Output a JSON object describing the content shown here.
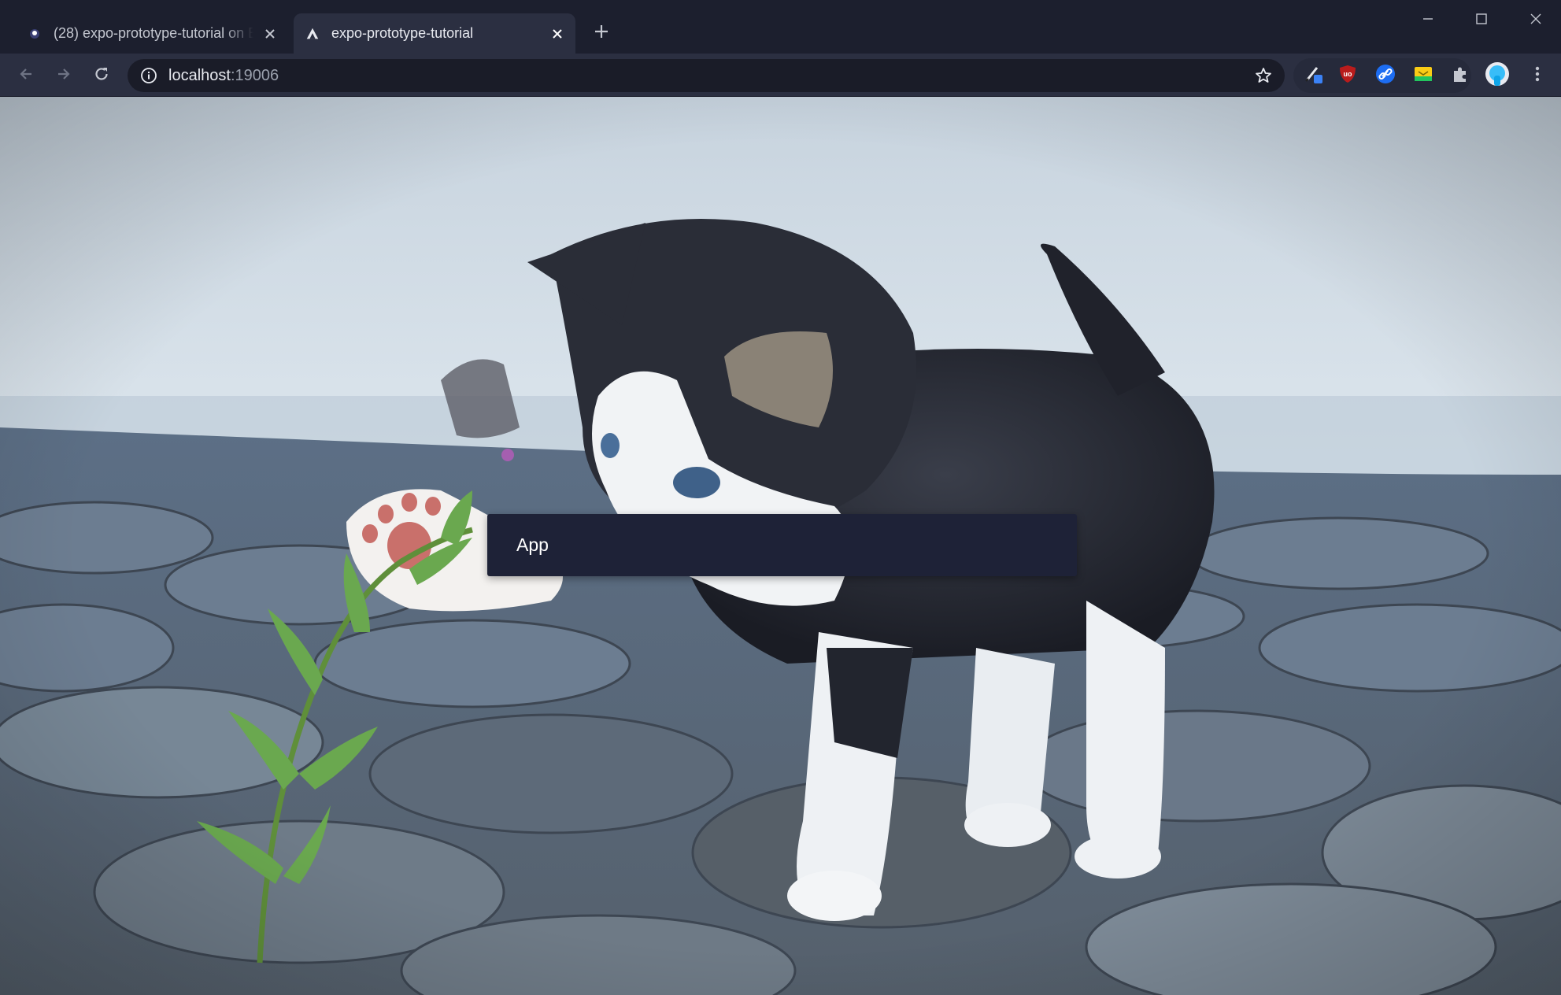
{
  "browser": {
    "tabs": [
      {
        "title": "(28) expo-prototype-tutorial on E",
        "active": false,
        "favicon": "twitch-icon"
      },
      {
        "title": "expo-prototype-tutorial",
        "active": true,
        "favicon": "expo-icon"
      }
    ],
    "new_tab_icon": "plus-icon",
    "window_controls": [
      "minimize-icon",
      "maximize-icon",
      "close-icon"
    ],
    "address": {
      "host": "localhost",
      "port": ":19006"
    },
    "nav_icons": [
      "back-arrow-icon",
      "forward-arrow-icon",
      "reload-icon"
    ],
    "extensions": [
      "color-picker-icon",
      "ublock-origin-icon",
      "link-icon",
      "sticky-note-icon",
      "puzzle-icon"
    ],
    "colors": {
      "tabstrip": "#1c1f2e",
      "toolbar": "#2b2f41",
      "omnibox": "#1a1c28"
    }
  },
  "page": {
    "app_title": "App",
    "app_bar_color": "#1e2237",
    "background": "kitten-photo"
  }
}
